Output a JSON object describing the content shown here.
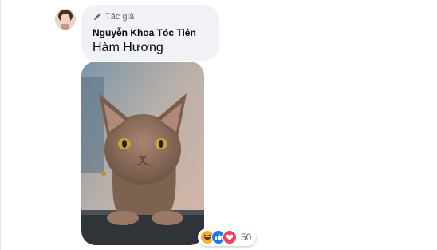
{
  "comment": {
    "author_badge": "Tác giả",
    "author_badge_icon": "pen-icon",
    "author_name": "Nguyễn Khoa Tóc Tiên",
    "text": "Hàm Hương"
  },
  "reactions": {
    "icons": [
      "haha-icon",
      "like-icon",
      "love-icon"
    ],
    "count": "50"
  },
  "colors": {
    "bubble_bg": "#f0f2f5",
    "secondary_text": "#65676b",
    "like_blue": "#1877f2",
    "love_red": "#f33e58",
    "haha_yellow": "#f7b125"
  }
}
